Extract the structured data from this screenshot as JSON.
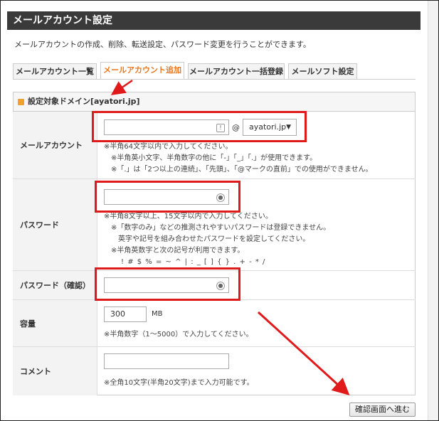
{
  "page": {
    "title": "メールアカウント設定",
    "description": "メールアカウントの作成、削除、転送設定、パスワード変更を行うことができます。"
  },
  "tabs": [
    {
      "label": "メールアカウント一覧"
    },
    {
      "label": "メールアカウント追加",
      "active": true
    },
    {
      "label": "メールアカウント一括登録"
    },
    {
      "label": "メールソフト設定"
    }
  ],
  "domain_bar": {
    "label": "設定対象ドメイン[ayatori.jp]"
  },
  "form": {
    "account": {
      "label": "メールアカウント",
      "value": "",
      "at": "@",
      "domain_select": "ayatori.jp",
      "notes": [
        "※半角64文字以内で入力してください。",
        "※半角英小文字、半角数字の他に「-」「_」「.」が使用できます。",
        "※「.」は「2つ以上の連続」、「先頭」、「@マークの直前」での使用ができません。"
      ]
    },
    "password": {
      "label": "パスワード",
      "value": "",
      "notes": [
        "※半角8文字以上、15文字以内で入力してください。",
        "※「数字のみ」などの推測されやすいパスワードは登録できません。",
        "英字や記号を組み合わせたパスワードを設定してください。",
        "※半角英数字と次の記号が利用できます。",
        "! # $ % = ~ ^ | : _ [ ] { } . + - * /"
      ]
    },
    "password_confirm": {
      "label": "パスワード（確認）",
      "value": ""
    },
    "capacity": {
      "label": "容量",
      "value": "300",
      "unit": "MB",
      "note": "※半角数字（1～5000）で入力してください。"
    },
    "comment": {
      "label": "コメント",
      "value": "",
      "note": "※全角10文字(半角20文字)まで入力可能です。"
    }
  },
  "submit_label": "確認画面へ進む",
  "colors": {
    "accent": "#e8771e",
    "highlight": "#e01a1a",
    "titlebar": "#3a3a3a"
  }
}
